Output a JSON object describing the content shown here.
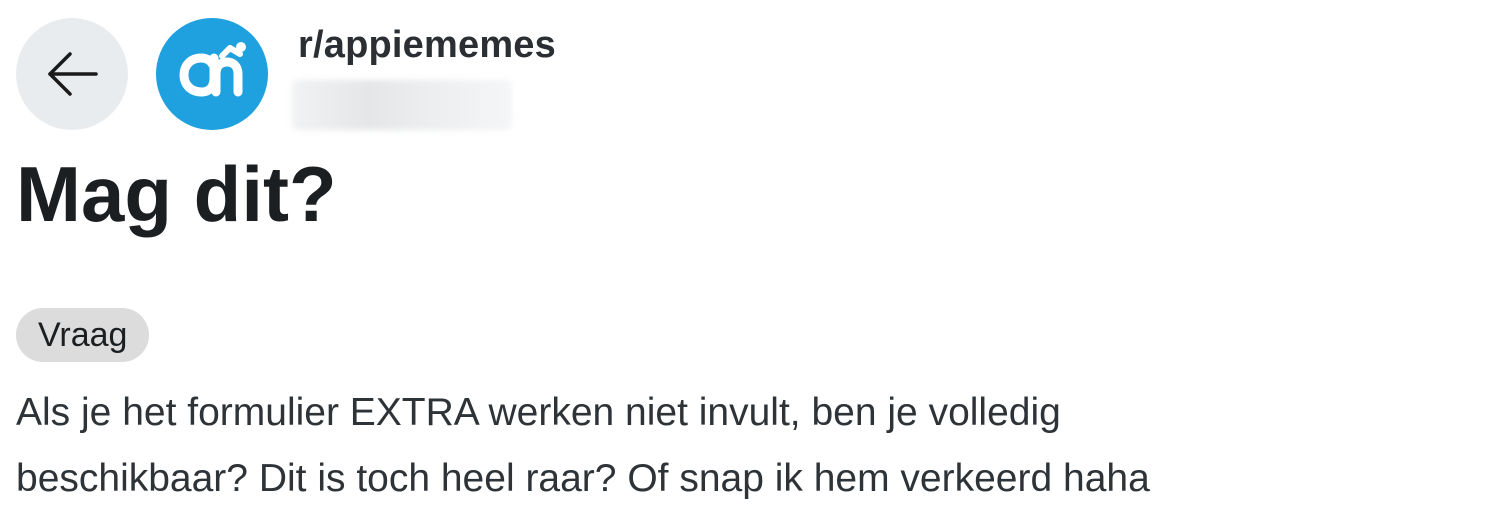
{
  "header": {
    "subreddit": "r/appiememes",
    "back_icon": "arrow-left-icon",
    "avatar_icon": "albert-heijn-logo",
    "accent_color": "#1fa1e0"
  },
  "post": {
    "title": "Mag dit?",
    "flair": "Vraag",
    "body": "Als je het formulier EXTRA werken niet invult, ben je volledig\nbeschikbaar? Dit is toch heel raar? Of snap ik hem verkeerd haha"
  }
}
